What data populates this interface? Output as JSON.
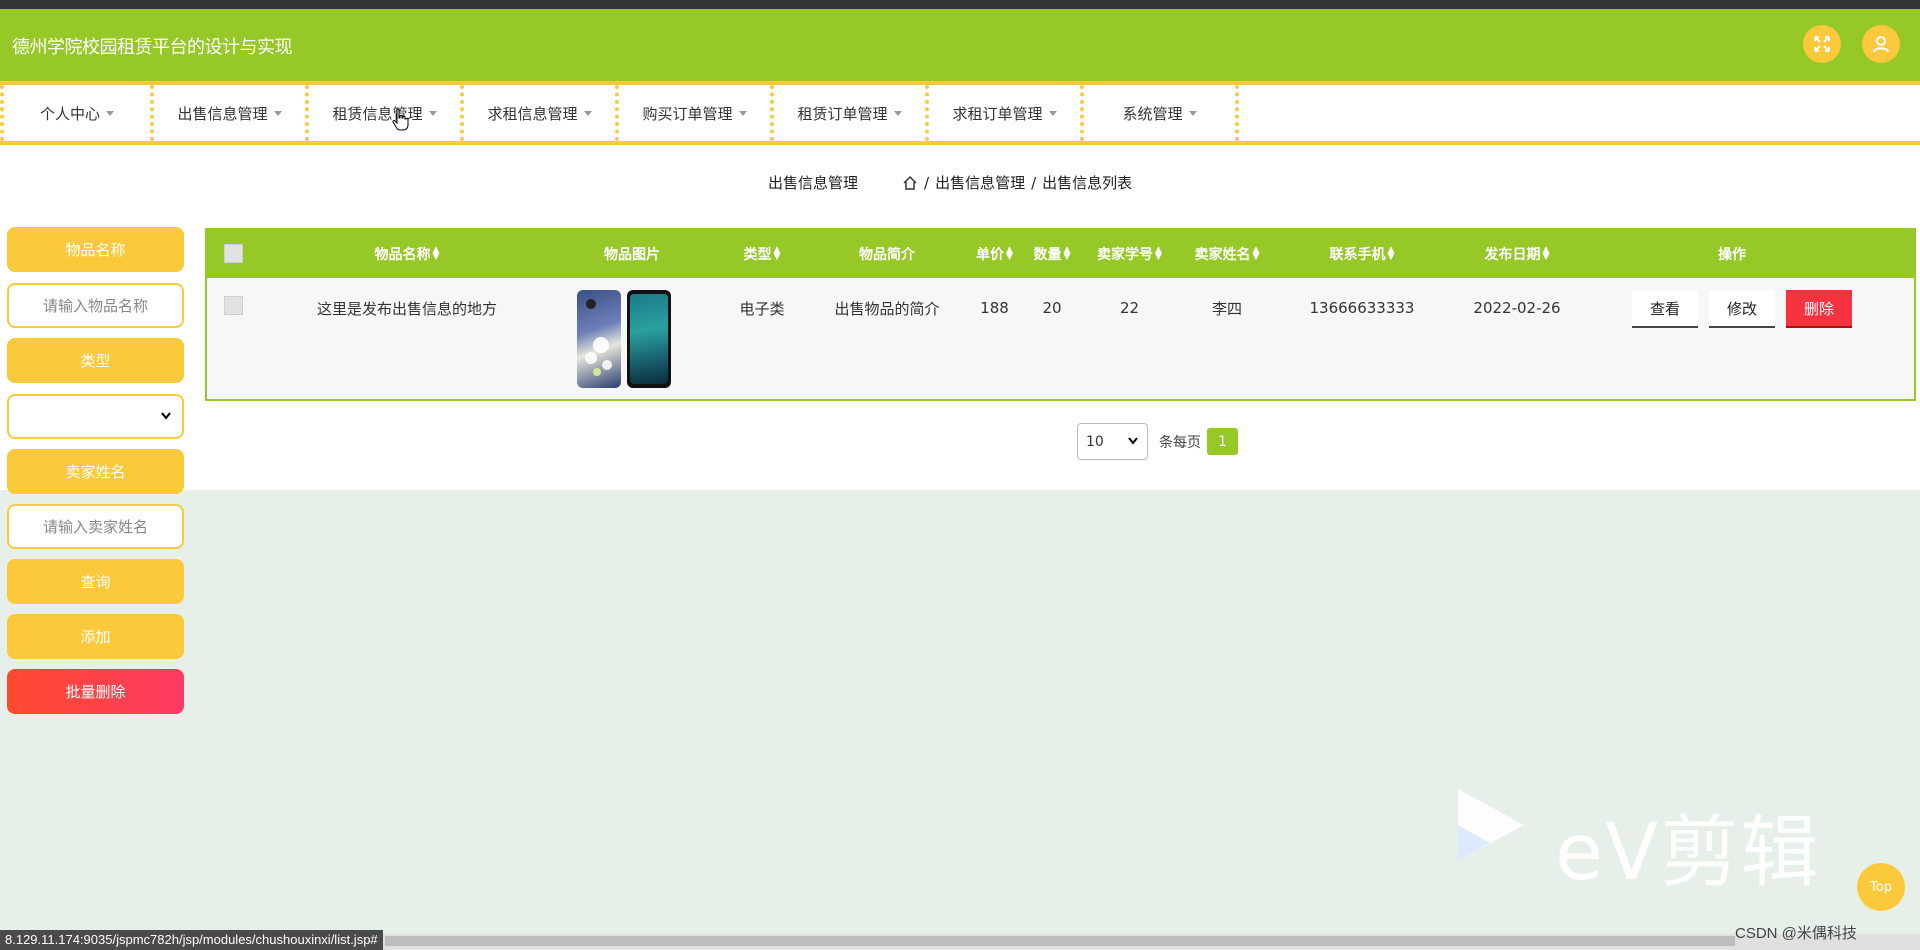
{
  "app": {
    "title": "德州学院校园租赁平台的设计与实现"
  },
  "header": {
    "expand_icon": "expand-icon",
    "user_icon": "user-icon"
  },
  "nav": {
    "items": [
      {
        "label": "个人中心"
      },
      {
        "label": "出售信息管理"
      },
      {
        "label": "租赁信息管理"
      },
      {
        "label": "求租信息管理"
      },
      {
        "label": "购买订单管理"
      },
      {
        "label": "租赁订单管理"
      },
      {
        "label": "求租订单管理"
      },
      {
        "label": "系统管理"
      }
    ]
  },
  "breadcrumb": {
    "section": "出售信息管理",
    "path": [
      "出售信息管理",
      "出售信息列表"
    ]
  },
  "search": {
    "item_name_label": "物品名称",
    "item_name_placeholder": "请输入物品名称",
    "type_label": "类型",
    "type_value": "",
    "seller_label": "卖家姓名",
    "seller_placeholder": "请输入卖家姓名",
    "query_button": "查询",
    "add_button": "添加",
    "batch_delete_button": "批量删除"
  },
  "table": {
    "columns": [
      "物品名称",
      "物品图片",
      "类型",
      "物品简介",
      "单价",
      "数量",
      "卖家学号",
      "卖家姓名",
      "联系手机",
      "发布日期",
      "操作"
    ],
    "rows": [
      {
        "name": "这里是发布出售信息的地方",
        "type": "电子类",
        "intro": "出售物品的简介",
        "price": "188",
        "quantity": "20",
        "seller_id": "22",
        "seller_name": "李四",
        "phone": "13666633333",
        "date": "2022-02-26",
        "actions": {
          "view": "查看",
          "edit": "修改",
          "delete": "删除"
        }
      }
    ]
  },
  "pagination": {
    "page_size": "10",
    "per_page_label": "条每页",
    "current_page": "1"
  },
  "overlay": {
    "ev_brand": "eV剪辑",
    "top_button": "Top",
    "watermark": "CSDN @米偶科技"
  },
  "statusbar": {
    "url": "8.129.11.174:9035/jspmc782h/jsp/modules/chushouxinxi/list.jsp#"
  },
  "colors": {
    "primary_green": "#96c828",
    "accent_yellow": "#fcc93d",
    "danger_red": "#f5333f"
  }
}
